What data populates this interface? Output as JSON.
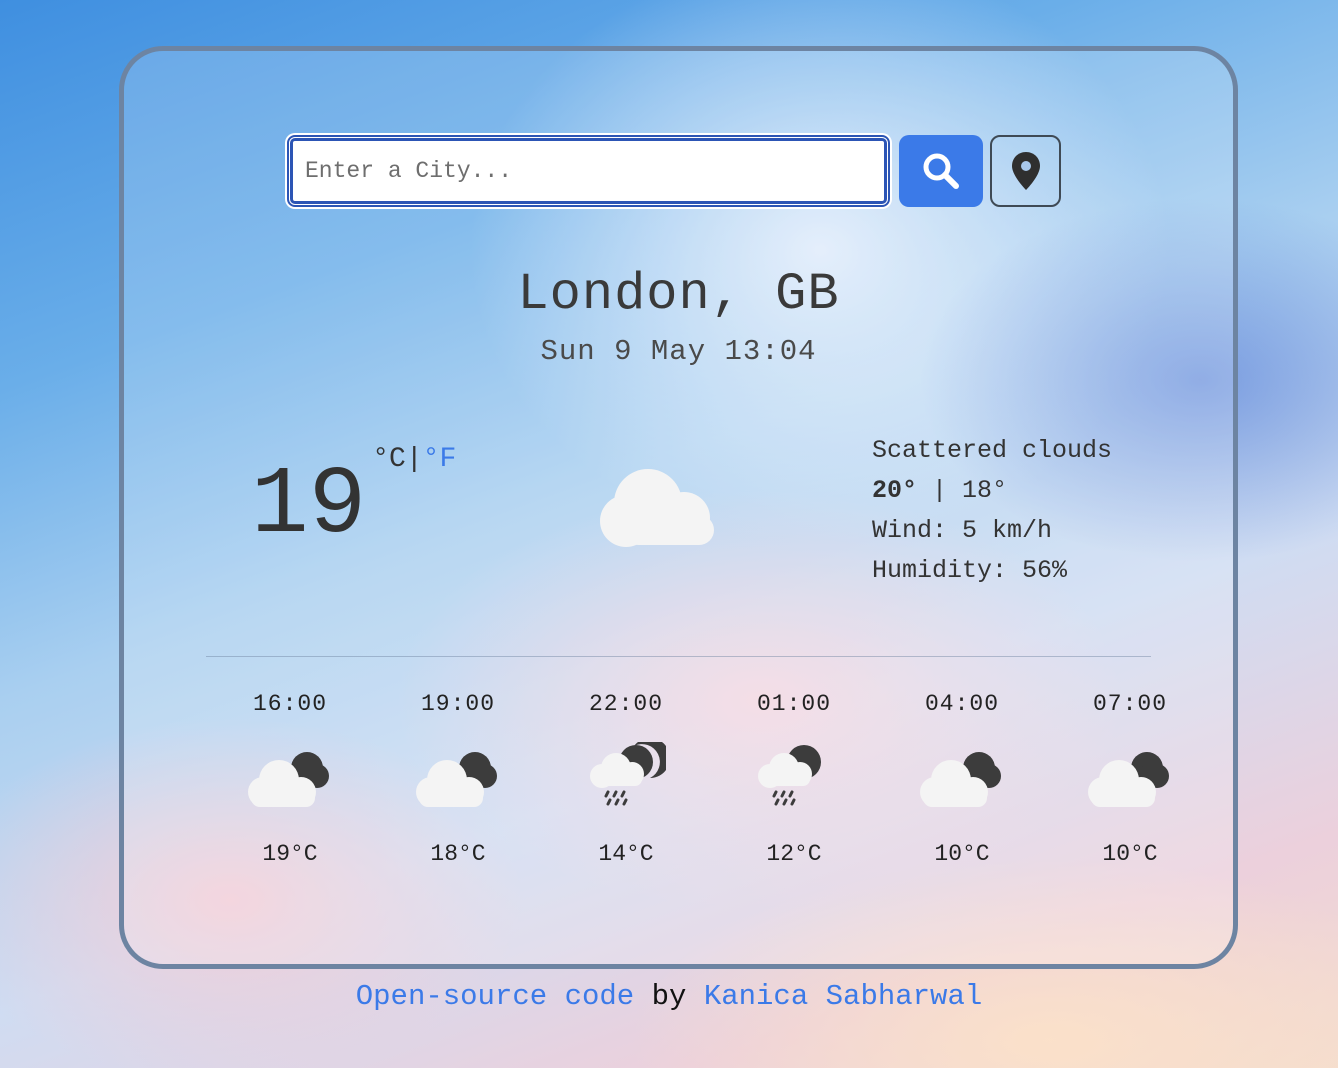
{
  "search": {
    "placeholder": "Enter a City...",
    "value": ""
  },
  "location": {
    "city": "London, GB",
    "datetime": "Sun 9 May 13:04"
  },
  "current": {
    "temperature": "19",
    "unit_c": "°C",
    "unit_separator": "|",
    "unit_f": "°F",
    "icon": "cloud-icon",
    "description": "Scattered clouds",
    "high": "20°",
    "low_separator": " | ",
    "low": "18°",
    "wind_label": "Wind: ",
    "wind_value": "5 km/h",
    "humidity_label": "Humidity: ",
    "humidity_value": "56%"
  },
  "forecast": [
    {
      "time": "16:00",
      "icon": "partly-cloudy-night-icon",
      "temp": "19°C"
    },
    {
      "time": "19:00",
      "icon": "partly-cloudy-night-icon",
      "temp": "18°C"
    },
    {
      "time": "22:00",
      "icon": "rain-night-icon",
      "temp": "14°C"
    },
    {
      "time": "01:00",
      "icon": "rain-night-icon",
      "temp": "12°C"
    },
    {
      "time": "04:00",
      "icon": "partly-cloudy-night-icon",
      "temp": "10°C"
    },
    {
      "time": "07:00",
      "icon": "partly-cloudy-night-icon",
      "temp": "10°C"
    }
  ],
  "footer": {
    "link_text": "Open-source code",
    "by": " by ",
    "author": "Kanica Sabharwal"
  },
  "colors": {
    "accent": "#3b7ae8",
    "card_border": "#6d84a2",
    "text": "#333333"
  }
}
